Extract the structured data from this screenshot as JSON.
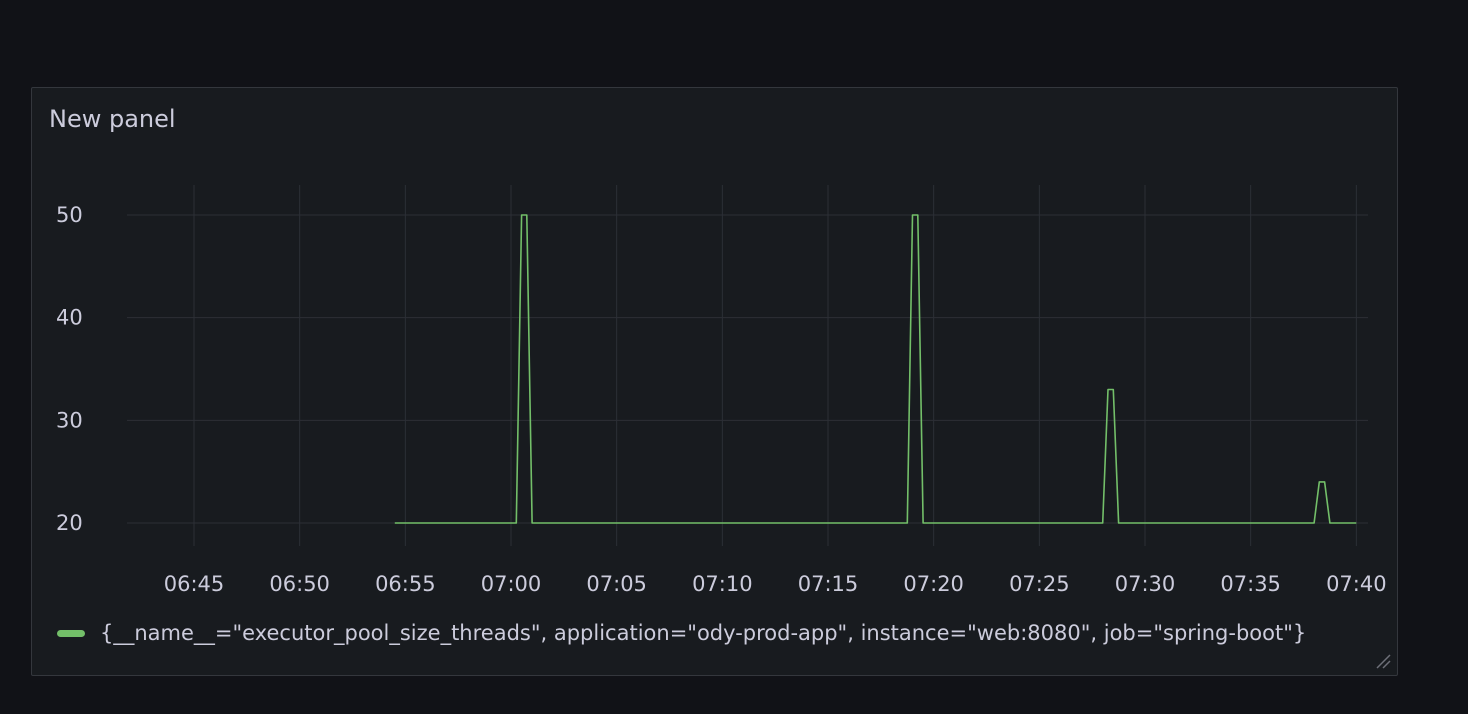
{
  "panel": {
    "title": "New panel"
  },
  "colors": {
    "series": "#73bf69",
    "grid": "#2c2f36",
    "text": "#ccccdc"
  },
  "chart_data": {
    "type": "line",
    "title": "New panel",
    "xlabel": "",
    "ylabel": "",
    "grid": true,
    "legend_position": "bottom-left",
    "x_ticks": [
      "06:45",
      "06:50",
      "06:55",
      "07:00",
      "07:05",
      "07:10",
      "07:15",
      "07:20",
      "07:25",
      "07:30",
      "07:35",
      "07:40"
    ],
    "y_ticks": [
      20,
      30,
      40,
      50
    ],
    "ylim": [
      17,
      53
    ],
    "series": [
      {
        "name": "{__name__=\"executor_pool_size_threads\", application=\"ody-prod-app\", instance=\"web:8080\", job=\"spring-boot\"}",
        "color": "#73bf69",
        "points": [
          [
            "06:54:30",
            20
          ],
          [
            "07:00:15",
            20
          ],
          [
            "07:00:30",
            50
          ],
          [
            "07:00:45",
            50
          ],
          [
            "07:01:00",
            20
          ],
          [
            "07:18:45",
            20
          ],
          [
            "07:19:00",
            50
          ],
          [
            "07:19:15",
            50
          ],
          [
            "07:19:30",
            20
          ],
          [
            "07:28:00",
            20
          ],
          [
            "07:28:15",
            33
          ],
          [
            "07:28:30",
            33
          ],
          [
            "07:28:45",
            20
          ],
          [
            "07:38:00",
            20
          ],
          [
            "07:38:15",
            24
          ],
          [
            "07:38:30",
            24
          ],
          [
            "07:38:45",
            20
          ],
          [
            "07:40:00",
            20
          ]
        ]
      }
    ]
  }
}
